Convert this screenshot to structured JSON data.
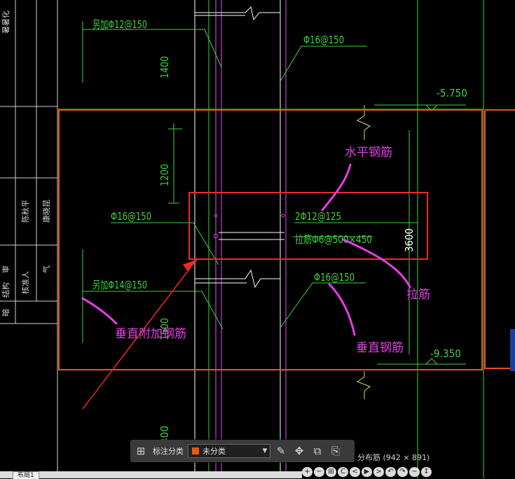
{
  "drawing": {
    "rebar_labels": {
      "top_add_vertical": "另加Φ12@150",
      "top_right_bar": "Φ16@150",
      "left_mid_bar": "Φ16@150",
      "horizontal_bar": "2Φ12@125",
      "tie_bar": "拉筋Φ6@500×450",
      "bottom_add_vertical": "另加Φ14@150",
      "bottom_right_bar": "Φ16@150"
    },
    "dimensions": {
      "dim_1400": "1400",
      "dim_1200": "1200",
      "dim_3600": "3600",
      "dim_1500": "1500",
      "dim_300": "300"
    },
    "elevations": {
      "top": "-5.750",
      "bottom": "-9.350"
    },
    "title_block": {
      "col_a": "暑暑化",
      "col_b": "陈秋平",
      "col_c": "康晓昆",
      "row_1": "审",
      "row_2": "核准人",
      "row_3": "气",
      "row_4": "结构",
      "row_5": "暗"
    }
  },
  "annotations": {
    "horizontal_rebar": "水平钢筋",
    "tie_rebar": "拉筋",
    "vertical_additional_rebar": "垂直附加钢筋",
    "vertical_rebar": "垂直钢筋"
  },
  "colors": {
    "cad_line": "#3ad53a",
    "cad_text": "#3ad53a",
    "wall_line": "#c040d0",
    "frame_orange": "#e8521e",
    "annotation_magenta": "#e53ee5",
    "annotation_red": "#ee2a20",
    "white_line": "#ffffff"
  },
  "toolbar": {
    "grid_icon": "grid-icon",
    "label": "标注分类",
    "category_value": "未分类",
    "category_color": "#e55a12",
    "edit_icon": "edit-icon",
    "move_icon": "move-icon",
    "copy_icon": "copy-icon",
    "paste_icon": "paste-icon"
  },
  "status": {
    "text": "分布筋 (942 × 891)"
  },
  "nav": {
    "buttons": [
      "+",
      "−",
      "⊞",
      "C",
      "<",
      "▶",
      ">",
      "↶",
      "↷",
      "−",
      "↕"
    ]
  },
  "layout_tab": {
    "label": "布局1"
  }
}
